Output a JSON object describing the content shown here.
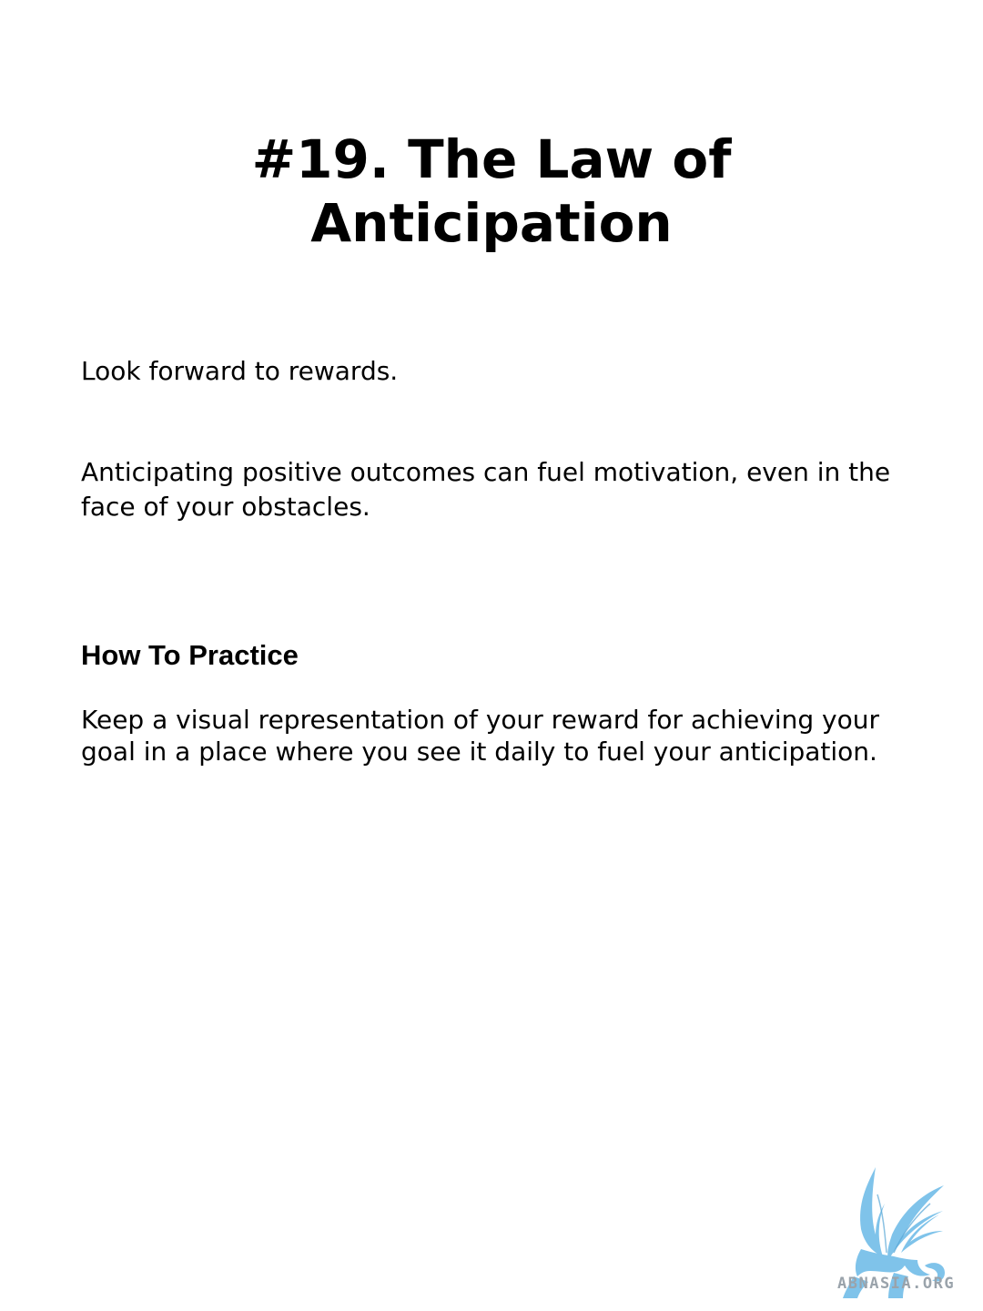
{
  "slide": {
    "title_line1": "#19. The Law of",
    "title_line2": "Anticipation",
    "intro": "Look forward to rewards.",
    "explanation": "Anticipating positive outcomes can fuel motivation, even in the face of your obstacles.",
    "practice_heading": "How To Practice",
    "practice_body": "Keep a visual representation of your reward for achieving your goal in a place where you see it daily to fuel your anticipation."
  },
  "watermark": {
    "text": "ABNASIA.ORG",
    "icon": "griffin-logo-icon",
    "color": "#7fc3ea"
  }
}
